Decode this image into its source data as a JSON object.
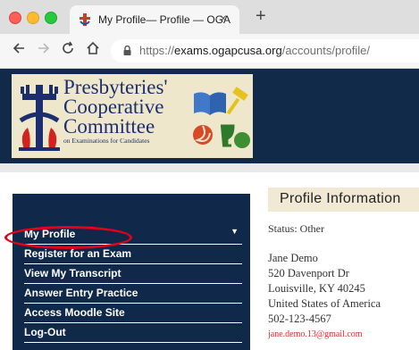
{
  "browser": {
    "tab_title": "My Profile— Profile — OGA",
    "close_glyph": "×",
    "new_tab_glyph": "+",
    "url_scheme": "https://",
    "url_host": "exams.ogapcusa.org",
    "url_path": "/accounts/profile/"
  },
  "header": {
    "logo_lines": [
      "Presbyteries'",
      "Cooperative",
      "Committee"
    ],
    "logo_subtitle": "on Examinations for Candidates"
  },
  "sidebar": {
    "items": [
      {
        "label": "My Profile"
      },
      {
        "label": "Register for an Exam"
      },
      {
        "label": "View My Transcript"
      },
      {
        "label": "Answer Entry Practice"
      },
      {
        "label": "Access Moodle Site"
      },
      {
        "label": "Log-Out"
      }
    ]
  },
  "profile": {
    "title": "Profile Information",
    "status": "Status: Other",
    "name": "Jane Demo",
    "street": "520 Davenport Dr",
    "city_line": "Louisville, KY 40245",
    "country": "United States of America",
    "phone": "502-123-4567",
    "email": "jane.demo.13@gmail.com"
  },
  "colors": {
    "navy": "#10294a",
    "highlight": "#e3001b",
    "email": "#d62a2a"
  }
}
